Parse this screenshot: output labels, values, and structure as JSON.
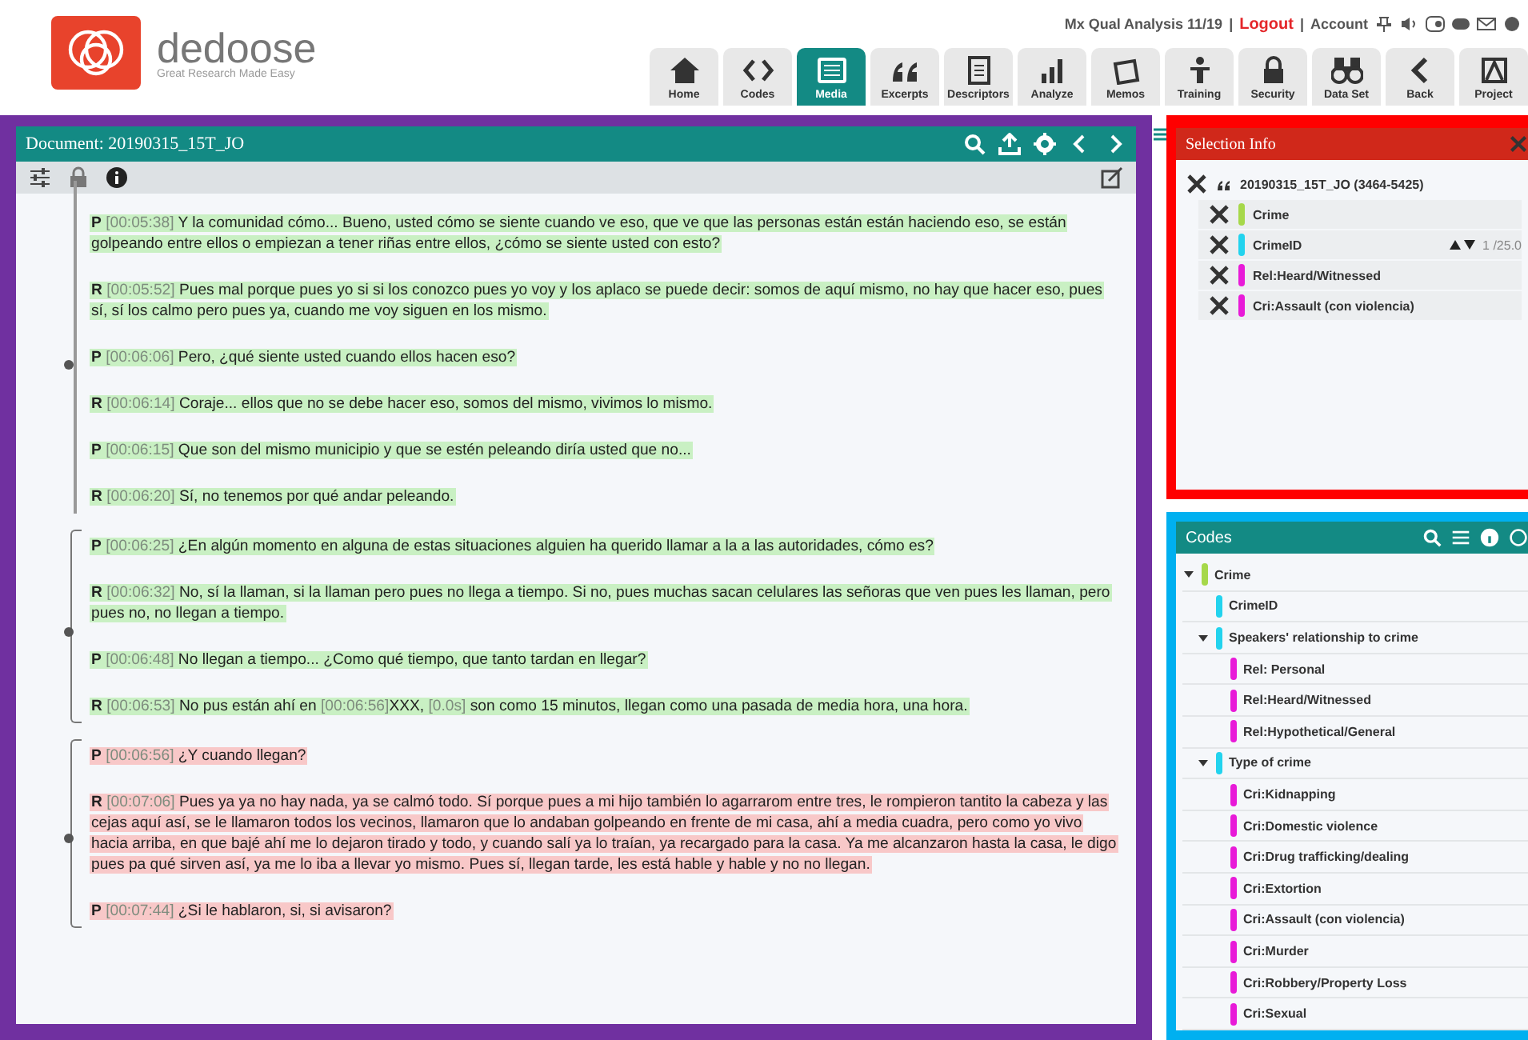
{
  "brand": {
    "name": "dedoose",
    "tagline": "Great Research Made Easy"
  },
  "top_links": [
    {
      "kind": "text",
      "label": "Mx Qual Analysis 11/19"
    },
    {
      "kind": "sep",
      "label": "|"
    },
    {
      "kind": "link",
      "label": "Logout"
    },
    {
      "kind": "sep",
      "label": "|"
    },
    {
      "kind": "text",
      "label": "Account"
    }
  ],
  "nav": [
    {
      "label": "Home",
      "kind": "home",
      "selected": false
    },
    {
      "label": "Codes",
      "kind": "code",
      "selected": false
    },
    {
      "label": "Media",
      "kind": "media",
      "selected": true
    },
    {
      "label": "Excerpts",
      "kind": "quote",
      "selected": false
    },
    {
      "label": "Descriptors",
      "kind": "doc",
      "selected": false
    },
    {
      "label": "Analyze",
      "kind": "bars",
      "selected": false
    },
    {
      "label": "Memos",
      "kind": "memo",
      "selected": false
    },
    {
      "label": "Training",
      "kind": "person",
      "selected": false
    },
    {
      "label": "Security",
      "kind": "lock",
      "selected": false
    },
    {
      "label": "Data Set",
      "kind": "binoculars",
      "selected": false
    },
    {
      "label": "Back",
      "kind": "back",
      "selected": false
    },
    {
      "label": "Project",
      "kind": "project",
      "selected": false
    }
  ],
  "document": {
    "title": "Document: 20190315_15T_JO",
    "excerpts": [
      {
        "kind": "line",
        "color": "#c9f0c3",
        "paragraphs": [
          {
            "speaker": "P",
            "parts": [
              {
                "kind": "time",
                "text": "[00:05:38]"
              },
              {
                "kind": "text",
                "text": " Y la comunidad cómo... Bueno, usted cómo se siente cuando ve eso, que ve que las personas están están haciendo eso, se están golpeando entre ellos o empiezan a tener riñas entre ellos, ¿cómo se siente usted con esto?"
              }
            ]
          },
          {
            "speaker": "R",
            "parts": [
              {
                "kind": "time",
                "text": "[00:05:52]"
              },
              {
                "kind": "text",
                "text": " Pues mal porque pues yo si si los conozco pues yo voy y los aplaco se puede decir: somos de aquí mismo, no hay que hacer eso, pues sí, sí los calmo pero pues ya, cuando me voy siguen en los mismo."
              }
            ]
          },
          {
            "speaker": "P",
            "parts": [
              {
                "kind": "time",
                "text": "[00:06:06]"
              },
              {
                "kind": "text",
                "text": " Pero, ¿qué siente usted cuando ellos hacen eso?"
              }
            ]
          },
          {
            "speaker": "R",
            "parts": [
              {
                "kind": "time",
                "text": "[00:06:14]"
              },
              {
                "kind": "text",
                "text": " Coraje... ellos que no se debe hacer eso, somos del mismo, vivimos lo mismo."
              }
            ]
          },
          {
            "speaker": "P",
            "parts": [
              {
                "kind": "time",
                "text": "[00:06:15]"
              },
              {
                "kind": "text",
                "text": " Que son del mismo municipio y que se estén peleando diría usted que no..."
              }
            ]
          },
          {
            "speaker": "R",
            "parts": [
              {
                "kind": "time",
                "text": "[00:06:20]"
              },
              {
                "kind": "text",
                "text": " Sí, no tenemos por qué andar peleando."
              }
            ]
          }
        ]
      },
      {
        "kind": "bracket",
        "color": "#c9f0c3",
        "paragraphs": [
          {
            "speaker": "P",
            "parts": [
              {
                "kind": "time",
                "text": "[00:06:25]"
              },
              {
                "kind": "text",
                "text": " ¿En algún momento en alguna de estas situaciones alguien ha querido llamar a la a las autoridades, cómo es?"
              }
            ]
          },
          {
            "speaker": "R",
            "parts": [
              {
                "kind": "time",
                "text": "[00:06:32]"
              },
              {
                "kind": "text",
                "text": "  No, sí la llaman, si la llaman pero pues no llega a tiempo. Si no, pues muchas sacan celulares las señoras que ven pues les llaman, pero pues no, no llegan a tiempo."
              }
            ]
          },
          {
            "speaker": "P",
            "parts": [
              {
                "kind": "time",
                "text": "[00:06:48]"
              },
              {
                "kind": "text",
                "text": " No llegan a tiempo... ¿Como qué tiempo, que tanto tardan en llegar?"
              }
            ]
          },
          {
            "speaker": "R",
            "parts": [
              {
                "kind": "time",
                "text": "[00:06:53]"
              },
              {
                "kind": "text",
                "text": " No pus están ahí en "
              },
              {
                "kind": "time",
                "text": "[00:06:56]"
              },
              {
                "kind": "text",
                "text": "XXX, "
              },
              {
                "kind": "time",
                "text": "[0.0s]"
              },
              {
                "kind": "text",
                "text": " son como 15 minutos, llegan como una pasada de media hora, una hora."
              }
            ]
          }
        ]
      },
      {
        "kind": "bracket",
        "color": "#f8c8c8",
        "paragraphs": [
          {
            "speaker": "P",
            "parts": [
              {
                "kind": "time",
                "text": "[00:06:56]"
              },
              {
                "kind": "text",
                "text": "  ¿Y cuando llegan?"
              }
            ]
          },
          {
            "speaker": "R",
            "parts": [
              {
                "kind": "time",
                "text": "[00:07:06]"
              },
              {
                "kind": "text",
                "text": " Pues ya ya no hay nada, ya se calmó todo. Sí porque pues a mi hijo también lo agarrarom entre tres, le rompieron tantito la cabeza y las cejas aquí así, se le llamaron todos los vecinos, llamaron que lo andaban golpeando en frente de mi casa, ahí a media cuadra, pero como yo vivo hacia arriba, en que bajé ahí me lo dejaron tirado y todo, y cuando salí ya lo traían, ya recargado para la casa. Ya me alcanzaron hasta la casa, le digo pues pa qué sirven así, ya me lo iba a llevar yo mismo. Pues sí, llegan tarde, les está hable y hable y no no llegan."
              }
            ]
          },
          {
            "speaker": "P",
            "parts": [
              {
                "kind": "time",
                "text": "[00:07:44]"
              },
              {
                "kind": "text",
                "text": " ¿Si le hablaron, si, si avisaron?"
              }
            ]
          }
        ]
      }
    ]
  },
  "selection_info": {
    "title": "Selection Info",
    "document": "20190315_15T_JO (3464-5425)",
    "codes": [
      {
        "label": "Crime",
        "color": "#a6d84a"
      },
      {
        "label": "CrimeID",
        "color": "#22d3ee",
        "weight": "1 /25.0"
      },
      {
        "label": "Rel:Heard/Witnessed",
        "color": "#e81ad8"
      },
      {
        "label": "Cri:Assault (con violencia)",
        "color": "#e81ad8"
      }
    ]
  },
  "codes": {
    "title": "Codes",
    "tree": [
      {
        "label": "Crime",
        "color": "#a6d84a",
        "expanded": true,
        "children": [
          {
            "label": "CrimeID",
            "color": "#22d3ee"
          },
          {
            "label": "Speakers' relationship to crime",
            "color": "#22d3ee",
            "expanded": true,
            "children": [
              {
                "label": "Rel: Personal",
                "color": "#e81ad8"
              },
              {
                "label": "Rel:Heard/Witnessed",
                "color": "#e81ad8"
              },
              {
                "label": "Rel:Hypothetical/General",
                "color": "#e81ad8"
              }
            ]
          },
          {
            "label": "Type of crime",
            "color": "#22d3ee",
            "expanded": true,
            "children": [
              {
                "label": "Cri:Kidnapping",
                "color": "#e81ad8"
              },
              {
                "label": "Cri:Domestic violence",
                "color": "#e81ad8"
              },
              {
                "label": "Cri:Drug trafficking/dealing",
                "color": "#e81ad8"
              },
              {
                "label": "Cri:Extortion",
                "color": "#e81ad8"
              },
              {
                "label": "Cri:Assault (con violencia)",
                "color": "#e81ad8"
              },
              {
                "label": "Cri:Murder",
                "color": "#e81ad8"
              },
              {
                "label": "Cri:Robbery/Property Loss",
                "color": "#e81ad8"
              },
              {
                "label": "Cri:Sexual",
                "color": "#e81ad8"
              }
            ]
          }
        ]
      }
    ]
  }
}
